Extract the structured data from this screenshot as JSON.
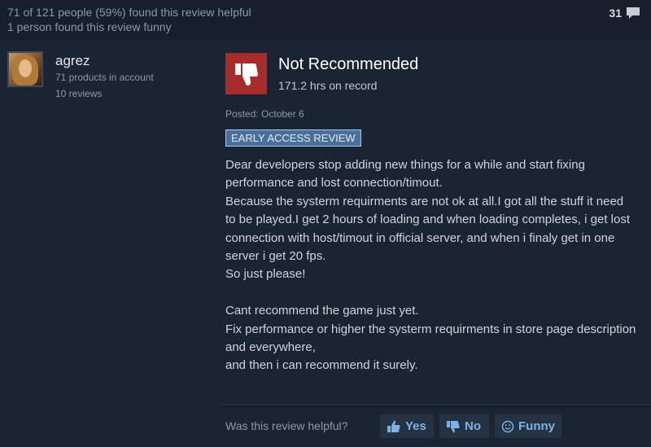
{
  "header": {
    "helpful_line": "71 of 121 people (59%) found this review helpful",
    "funny_line": "1 person found this review funny",
    "comment_count": "31",
    "comment_icon": "speech-bubble-icon"
  },
  "author": {
    "name": "agrez",
    "products": "71 products in account",
    "reviews": "10 reviews"
  },
  "review": {
    "verdict": "Not Recommended",
    "verdict_icon": "thumbs-down-icon",
    "hours": "171.2 hrs on record",
    "posted": "Posted: October 6",
    "badge": "EARLY ACCESS REVIEW",
    "body": "Dear developers stop adding new things for a while and start fixing performance and lost connection/timout.\nBecause the systerm requirments are not ok at all.I got all the stuff it need to be played.I get 2 hours of loading and when loading completes, i get lost connection with host/timout in official server, and when i finaly get in one server i get 20 fps.\nSo just please!\n\nCant recommend the game just yet.\nFix performance or higher the systerm requirments in store page description and everywhere,\nand then i can recommend it surely."
  },
  "votes": {
    "question": "Was this review helpful?",
    "yes_label": "Yes",
    "no_label": "No",
    "funny_label": "Funny"
  },
  "colors": {
    "background": "#1b2433",
    "not_recommended_red": "#a82c2c",
    "vote_text_blue": "#7db3e4",
    "badge_blue": "#4b6f9c"
  }
}
